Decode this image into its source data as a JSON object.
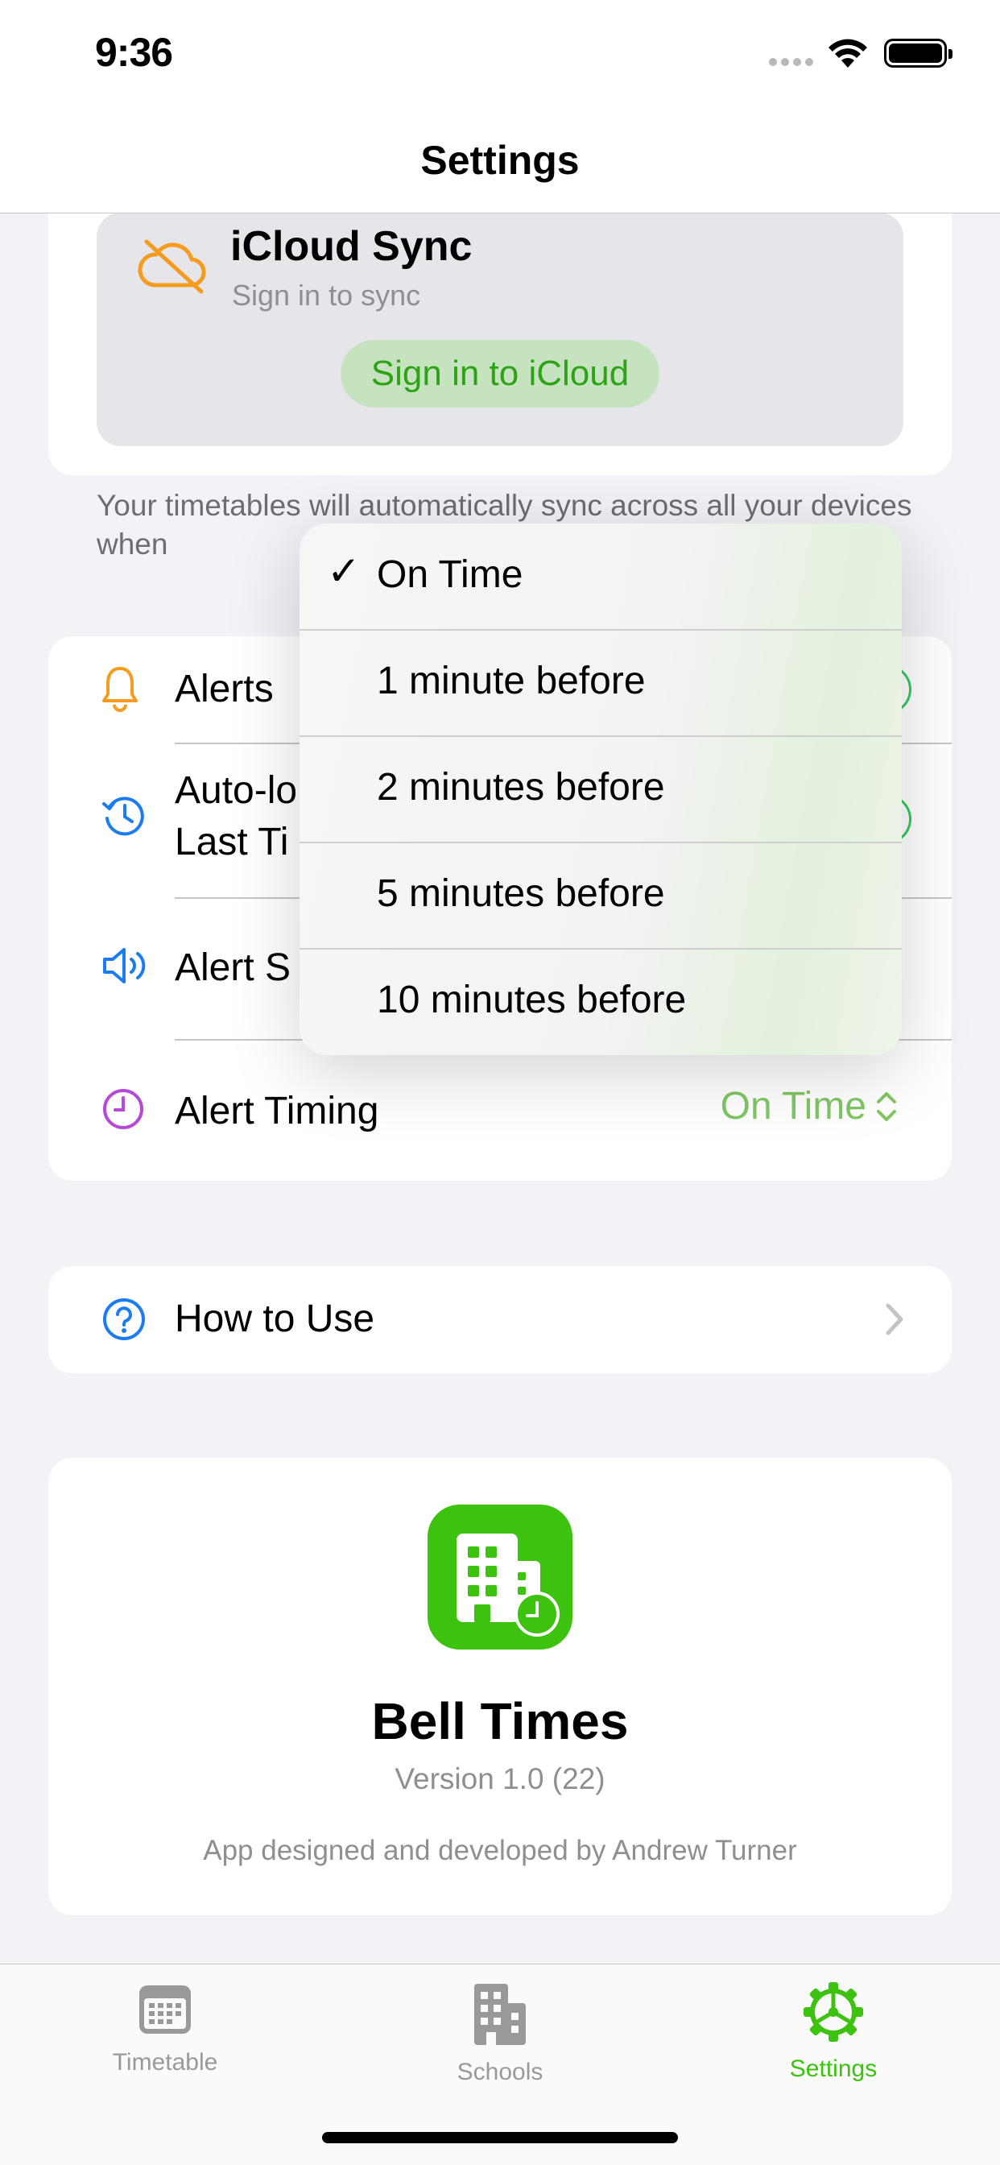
{
  "status_bar": {
    "time": "9:36"
  },
  "nav": {
    "title": "Settings"
  },
  "icloud": {
    "title": "iCloud Sync",
    "subtitle": "Sign in to sync",
    "button_label": "Sign in to iCloud",
    "footer_note": "Your timetables will automatically sync across all your devices when"
  },
  "alerts_section": {
    "rows": [
      {
        "label": "Alerts",
        "toggle_on": true
      },
      {
        "label_line1": "Auto-lo",
        "label_line2": "Last Ti",
        "toggle_on": true
      },
      {
        "label": "Alert S"
      },
      {
        "label": "Alert Timing",
        "value": "On Time"
      }
    ]
  },
  "alert_timing_menu": {
    "selected_index": 0,
    "options": [
      "On Time",
      "1 minute before",
      "2 minutes before",
      "5 minutes before",
      "10 minutes before"
    ]
  },
  "how_to_use": {
    "label": "How to Use"
  },
  "about": {
    "app_name": "Bell Times",
    "version": "Version 1.0 (22)",
    "credit": "App designed and developed by Andrew Turner"
  },
  "tab_bar": {
    "tabs": [
      {
        "label": "Timetable",
        "icon": "calendar-icon",
        "active": false
      },
      {
        "label": "Schools",
        "icon": "building-icon",
        "active": false
      },
      {
        "label": "Settings",
        "icon": "gear-icon",
        "active": true
      }
    ]
  },
  "colors": {
    "accent": "#3cc20f",
    "toggle": "#34c759",
    "orange": "#f59b1f",
    "blue": "#1a7cf0",
    "purple": "#b44ad6"
  }
}
